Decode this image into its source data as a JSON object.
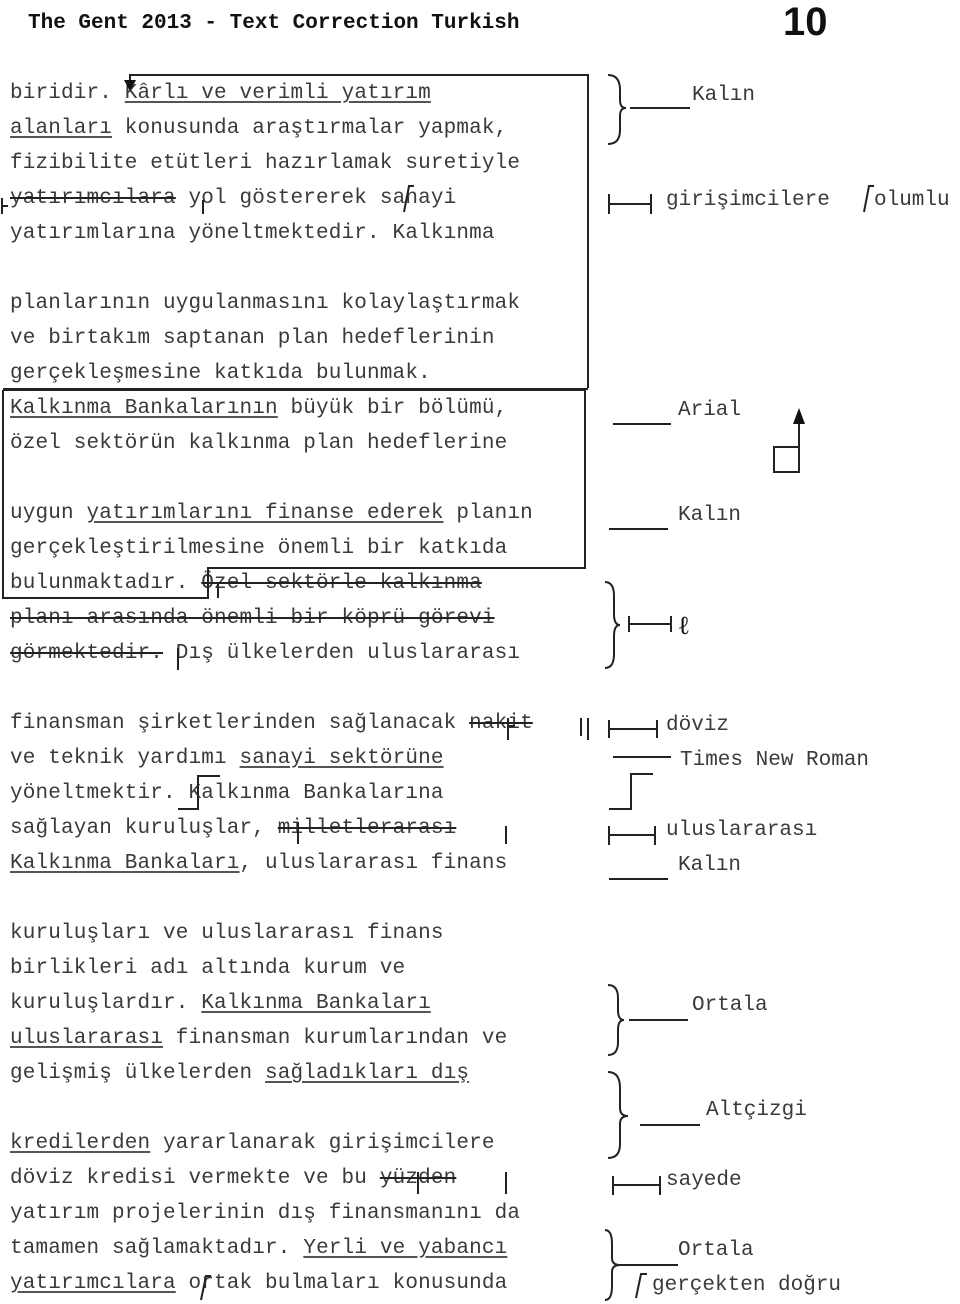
{
  "header": {
    "title": "The Gent 2013 - Text Correction Turkish",
    "page_number": "10"
  },
  "body_lines": [
    {
      "parts": [
        {
          "t": "biridir. "
        },
        {
          "t": "Kârlı ve verimli yatırım",
          "style": "underline"
        }
      ]
    },
    {
      "parts": [
        {
          "t": "alanları",
          "style": "underline"
        },
        {
          "t": " konusunda araştırmalar yapmak,"
        }
      ]
    },
    {
      "parts": [
        {
          "t": "fizibilite etütleri hazırlamak suretiyle"
        }
      ]
    },
    {
      "parts": [
        {
          "t": "yatırımcılara",
          "style": "strike"
        },
        {
          "t": " yol göstererek "
        },
        {
          "t": "sanayi"
        }
      ]
    },
    {
      "parts": [
        {
          "t": "yatırımlarına yöneltmektedir. Kalkınma"
        }
      ]
    },
    {
      "parts": [
        {
          "t": "planlarının uygulanmasını kolaylaştırmak"
        }
      ]
    },
    {
      "parts": [
        {
          "t": "ve birtakım saptanan plan hedeflerinin"
        }
      ]
    },
    {
      "parts": [
        {
          "t": "gerçekleşmesine katkıda bulunmak."
        }
      ]
    },
    {
      "parts": [
        {
          "t": "Kalkınma Bankalarının",
          "style": "underline"
        },
        {
          "t": " büyük bir bölümü,"
        }
      ]
    },
    {
      "parts": [
        {
          "t": "özel sektörün kalkınma plan hedeflerine"
        }
      ]
    },
    {
      "parts": [
        {
          "t": "uygun "
        },
        {
          "t": "yatırımlarını finanse ederek",
          "style": "underline"
        },
        {
          "t": " planın"
        }
      ]
    },
    {
      "parts": [
        {
          "t": "gerçekleştirilmesine önemli bir katkıda"
        }
      ]
    },
    {
      "parts": [
        {
          "t": "bulunmaktadır. "
        },
        {
          "t": "Özel sektörle kalkınma",
          "style": "strike"
        }
      ]
    },
    {
      "parts": [
        {
          "t": "planı arasında önemli bir köprü görevi",
          "style": "strike"
        }
      ]
    },
    {
      "parts": [
        {
          "t": "görmektedir.",
          "style": "strike"
        },
        {
          "t": " Dış ülkelerden uluslararası"
        }
      ]
    },
    {
      "parts": [
        {
          "t": "finansman şirketlerinden sağlanacak "
        },
        {
          "t": "nakit",
          "style": "strike"
        }
      ]
    },
    {
      "parts": [
        {
          "t": "ve teknik yardımı "
        },
        {
          "t": "sanayi sektörüne",
          "style": "underline"
        }
      ]
    },
    {
      "parts": [
        {
          "t": "yöneltmektir. Kalkınma Bankalarına"
        }
      ]
    },
    {
      "parts": [
        {
          "t": "sağlayan kuruluşlar, "
        },
        {
          "t": "milletlerarası",
          "style": "strike"
        }
      ]
    },
    {
      "parts": [
        {
          "t": "Kalkınma Bankaları",
          "style": "underline"
        },
        {
          "t": ", uluslararası finans"
        }
      ]
    },
    {
      "parts": [
        {
          "t": "kuruluşları ve uluslararası finans"
        }
      ]
    },
    {
      "parts": [
        {
          "t": "birlikleri adı altında kurum ve"
        }
      ]
    },
    {
      "parts": [
        {
          "t": "kuruluşlardır. "
        },
        {
          "t": "Kalkınma Bankaları",
          "style": "underline"
        }
      ]
    },
    {
      "parts": [
        {
          "t": "uluslararası",
          "style": "underline"
        },
        {
          "t": " finansman kurumlarından ve"
        }
      ]
    },
    {
      "parts": [
        {
          "t": "gelişmiş ülkelerden "
        },
        {
          "t": "sağladıkları dış",
          "style": "underline"
        }
      ]
    },
    {
      "parts": [
        {
          "t": "kredilerden",
          "style": "underline"
        },
        {
          "t": " yararlanarak girişimcilere"
        }
      ]
    },
    {
      "parts": [
        {
          "t": "döviz kredisi vermekte ve bu "
        },
        {
          "t": "yüzden",
          "style": "strike"
        }
      ]
    },
    {
      "parts": [
        {
          "t": "yatırım projelerinin dış finansmanını da"
        }
      ]
    },
    {
      "parts": [
        {
          "t": "tamamen sağlamaktadır. "
        },
        {
          "t": "Yerli ve yabancı",
          "style": "underline"
        }
      ]
    },
    {
      "parts": [
        {
          "t": "yatırımcılara",
          "style": "underline"
        },
        {
          "t": " ortak bulmaları konusunda"
        }
      ]
    }
  ],
  "margin_notes": [
    {
      "mark": "brace-line",
      "text": "Kalın"
    },
    {
      "mark": "replace-bar",
      "text": "girişimcilere"
    },
    {
      "mark": "insert-caret",
      "text": "olumlu"
    },
    {
      "mark": "line",
      "text": "Arial"
    },
    {
      "mark": "move-up-box",
      "text": ""
    },
    {
      "mark": "line",
      "text": "Kalın"
    },
    {
      "mark": "brace-delete",
      "text": ""
    },
    {
      "mark": "replace-bar",
      "text": "döviz"
    },
    {
      "mark": "line",
      "text": "Times New Roman"
    },
    {
      "mark": "new-paragraph",
      "text": ""
    },
    {
      "mark": "replace-bar",
      "text": "uluslararası"
    },
    {
      "mark": "line",
      "text": "Kalın"
    },
    {
      "mark": "brace-line",
      "text": "Ortala"
    },
    {
      "mark": "brace-line",
      "text": "Altçizgi"
    },
    {
      "mark": "replace-bar",
      "text": "sayede"
    },
    {
      "mark": "brace-line",
      "text": "Ortala"
    },
    {
      "mark": "insert-caret",
      "text": "gerçekten doğru"
    }
  ]
}
